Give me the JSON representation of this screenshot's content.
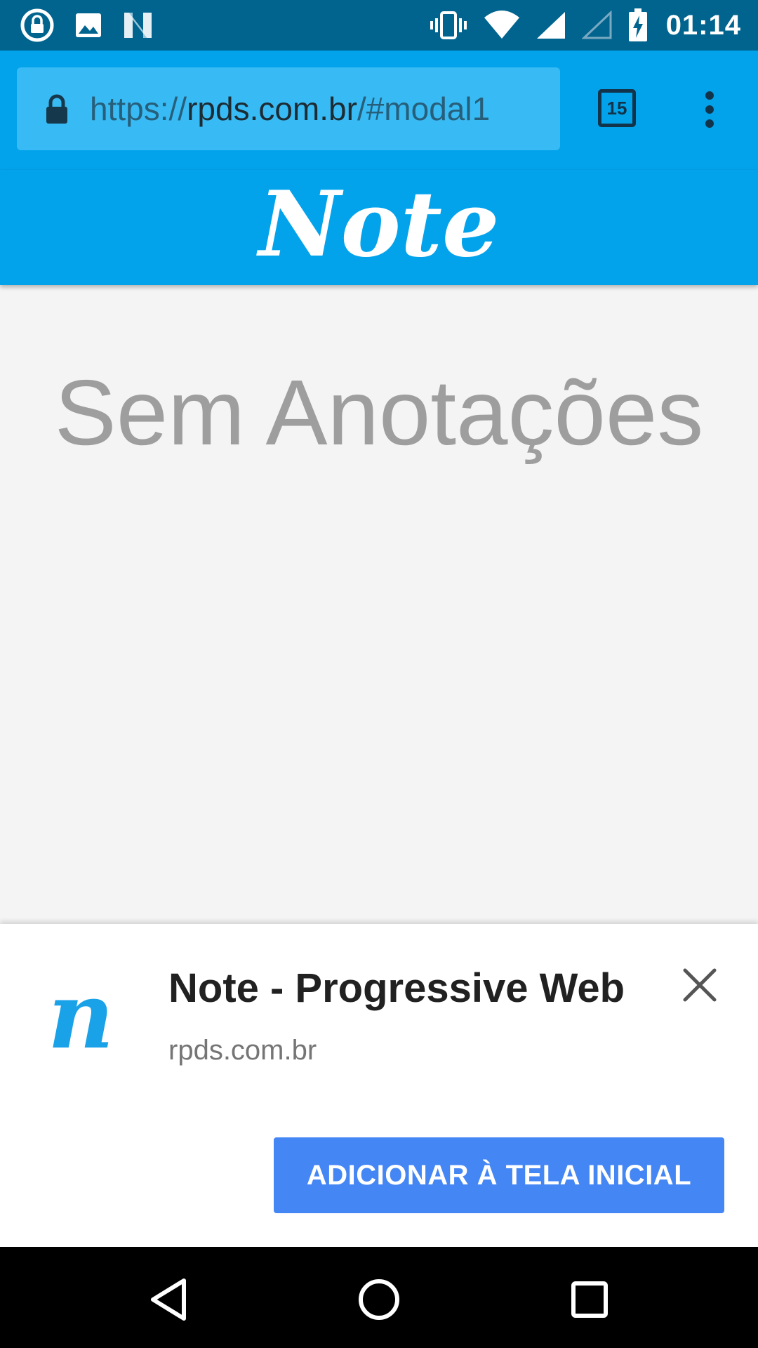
{
  "status_bar": {
    "time": "01:14",
    "left_icons": [
      "lock-rotate-icon",
      "image-icon",
      "n-icon"
    ],
    "right_icons": [
      "vibrate-icon",
      "wifi-icon",
      "signal-icon",
      "signal-empty-icon",
      "battery-charging-icon"
    ]
  },
  "browser": {
    "url_scheme": "https://",
    "url_host": "rpds.com.br",
    "url_path": "/#modal1",
    "tab_count": "15",
    "toolbar_color": "#03a3ec"
  },
  "app": {
    "logo": "Note",
    "empty_message": "Sem Anotações"
  },
  "install_banner": {
    "icon_glyph": "n",
    "app_name": "Note - Progressive Web",
    "host": "rpds.com.br",
    "add_button_label": "ADICIONAR À TELA INICIAL",
    "button_color": "#4486f4"
  },
  "nav_bar": {
    "buttons": [
      "back-icon",
      "home-icon",
      "recents-icon"
    ]
  }
}
